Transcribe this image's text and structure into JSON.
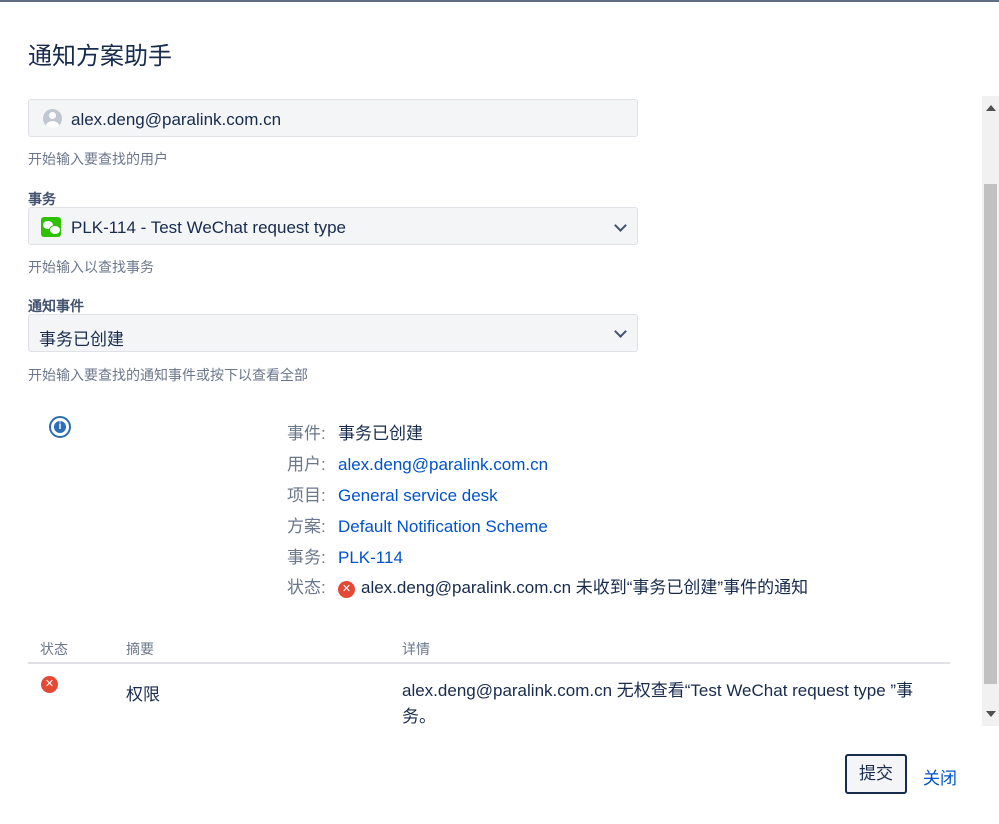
{
  "dialog": {
    "title": "通知方案助手",
    "submit_label": "提交",
    "close_label": "关闭"
  },
  "form": {
    "user": {
      "value": "alex.deng@paralink.com.cn",
      "help": "开始输入要查找的用户"
    },
    "issue": {
      "label": "事务",
      "value": "PLK-114 - Test WeChat request type",
      "help": "开始输入以查找事务"
    },
    "event": {
      "label": "通知事件",
      "value": "事务已创建",
      "help": "开始输入要查找的通知事件或按下以查看全部"
    }
  },
  "summary": {
    "event": {
      "key": "事件:",
      "value": "事务已创建"
    },
    "user": {
      "key": "用户:",
      "value": "alex.deng@paralink.com.cn"
    },
    "project": {
      "key": "项目:",
      "value": "General service desk"
    },
    "scheme": {
      "key": "方案:",
      "value": "Default Notification Scheme"
    },
    "issue": {
      "key": "事务:",
      "value": "PLK-114"
    },
    "status": {
      "key": "状态:",
      "value": "alex.deng@paralink.com.cn 未收到“事务已创建”事件的通知"
    }
  },
  "table": {
    "headers": {
      "status": "状态",
      "summary": "摘要",
      "details": "详情"
    },
    "rows": [
      {
        "summary": "权限",
        "details": "alex.deng@paralink.com.cn 无权查看“Test WeChat request type ”事务。"
      }
    ]
  },
  "colors": {
    "link": "#0052cc",
    "error": "#e34935",
    "info": "#2d6db5",
    "wechat": "#2dc100"
  }
}
